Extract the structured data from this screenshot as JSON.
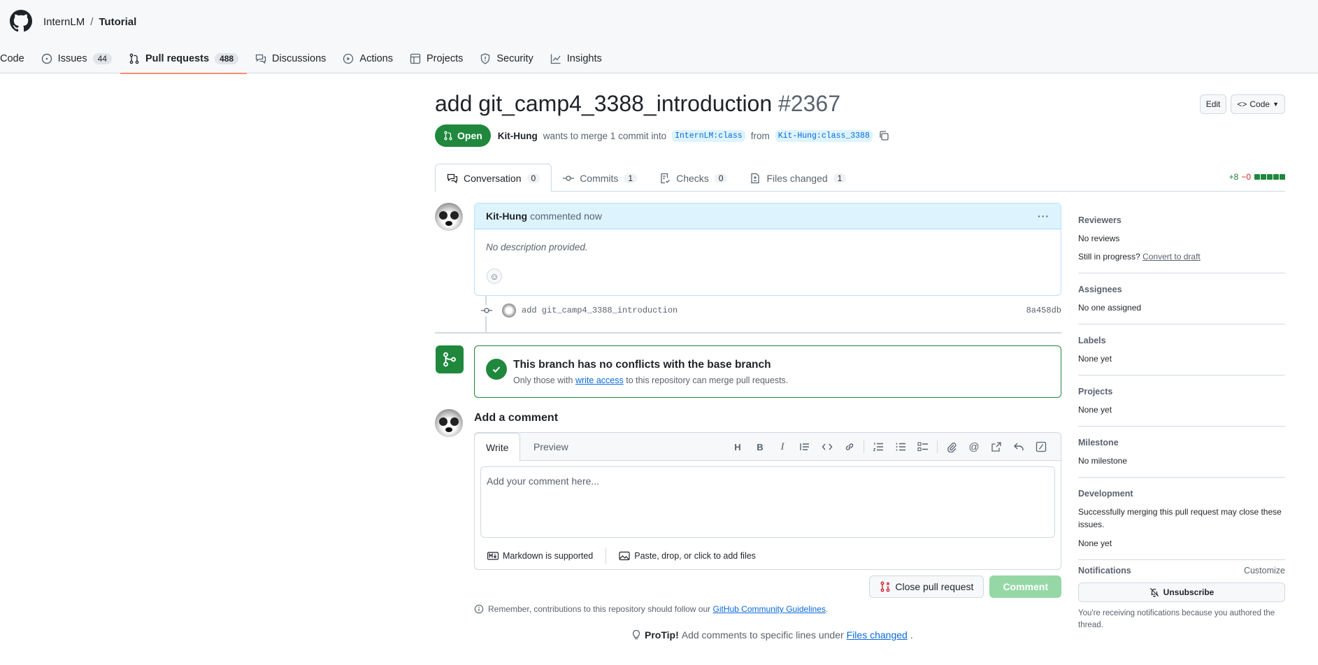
{
  "header": {
    "owner": "InternLM",
    "separator": "/",
    "repo": "Tutorial",
    "nav": [
      {
        "label": "Code",
        "icon": "code-icon"
      },
      {
        "label": "Issues",
        "count": "44",
        "icon": "issue-icon"
      },
      {
        "label": "Pull requests",
        "count": "488",
        "icon": "pull-request-icon"
      },
      {
        "label": "Discussions",
        "icon": "discussion-icon"
      },
      {
        "label": "Actions",
        "icon": "play-icon"
      },
      {
        "label": "Projects",
        "icon": "table-icon"
      },
      {
        "label": "Security",
        "icon": "shield-icon"
      },
      {
        "label": "Insights",
        "icon": "graph-icon"
      }
    ]
  },
  "pr": {
    "title": "add git_camp4_3388_introduction",
    "number": "#2367",
    "edit_label": "Edit",
    "code_label": "Code",
    "state": "Open",
    "author": "Kit-Hung",
    "merge_text": "wants to merge 1 commit into",
    "base_branch": "InternLM:class",
    "from_text": "from",
    "head_branch": "Kit-Hung:class_3388"
  },
  "tabs": [
    {
      "label": "Conversation",
      "count": "0"
    },
    {
      "label": "Commits",
      "count": "1"
    },
    {
      "label": "Checks",
      "count": "0"
    },
    {
      "label": "Files changed",
      "count": "1"
    }
  ],
  "diffstat": {
    "additions": "+8",
    "deletions": "−0"
  },
  "comment": {
    "author": "Kit-Hung",
    "action": "commented now",
    "body": "No description provided."
  },
  "commit": {
    "message": "add git_camp4_3388_introduction",
    "sha": "8a458db"
  },
  "merge": {
    "title": "This branch has no conflicts with the base branch",
    "sub_before": "Only those with",
    "sub_link": "write access",
    "sub_after": "to this repository can merge pull requests."
  },
  "add_comment": {
    "title": "Add a comment",
    "tab_write": "Write",
    "tab_preview": "Preview",
    "placeholder": "Add your comment here...",
    "markdown_note": "Markdown is supported",
    "attach_note": "Paste, drop, or click to add files",
    "close_label": "Close pull request",
    "comment_label": "Comment"
  },
  "remember": {
    "before": "Remember, contributions to this repository should follow our",
    "link": "GitHub Community Guidelines",
    "after": "."
  },
  "protip": {
    "label": "ProTip!",
    "before": "Add comments to specific lines under",
    "link": "Files changed",
    "after": "."
  },
  "sidebar": {
    "reviewers": {
      "title": "Reviewers",
      "value": "No reviews",
      "progress": "Still in progress?",
      "draft_link": "Convert to draft"
    },
    "assignees": {
      "title": "Assignees",
      "value": "No one assigned"
    },
    "labels": {
      "title": "Labels",
      "value": "None yet"
    },
    "projects": {
      "title": "Projects",
      "value": "None yet"
    },
    "milestone": {
      "title": "Milestone",
      "value": "No milestone"
    },
    "development": {
      "title": "Development",
      "desc": "Successfully merging this pull request may close these issues.",
      "value": "None yet"
    },
    "notifications": {
      "title": "Notifications",
      "customize": "Customize",
      "button": "Unsubscribe",
      "note": "You're receiving notifications because you authored the thread."
    }
  },
  "colors": {
    "accent": "#0969da",
    "open_green": "#1f883d",
    "active_tab": "#fd8c73"
  }
}
